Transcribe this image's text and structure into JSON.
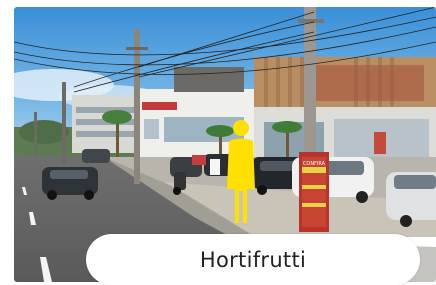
{
  "street_view": {
    "scene_description_icon": "street-scene",
    "shop_sign_text": "CONFIRA"
  },
  "marker": {
    "icon": "pegman-icon",
    "color": "#ffe000"
  },
  "location_card": {
    "place_name": "Hortifrutti"
  }
}
